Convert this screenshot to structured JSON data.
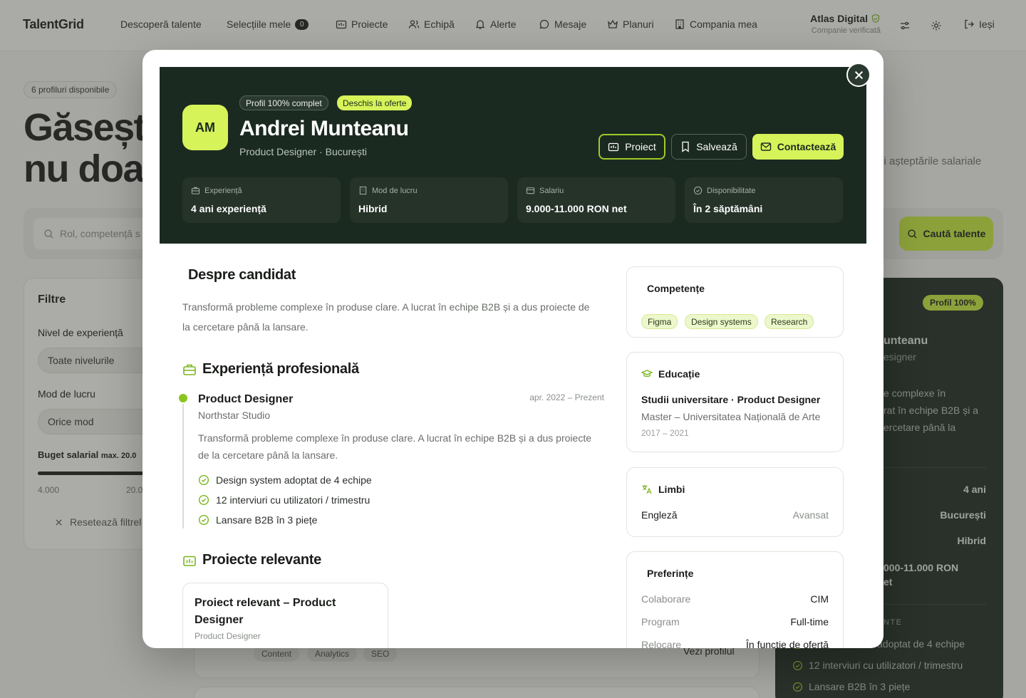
{
  "topnav": {
    "logo": "TalentGrid",
    "items": [
      "Descoperă talente",
      "Selecțiile mele",
      "Proiecte",
      "Echipă",
      "Alerte",
      "Mesaje",
      "Planuri",
      "Compania mea"
    ],
    "selections_count": "0",
    "company_name": "Atlas Digital",
    "company_status": "Companie verificată",
    "logout": "Ieși"
  },
  "background": {
    "profiles_pill": "6 profiluri disponibile",
    "hero_line1": "Găsește",
    "hero_line2": "nu doa",
    "hero_side": "și așteptările salariale",
    "search_placeholder": "Rol, competență s",
    "search_button": "Caută talente",
    "filters_title": "Filtre",
    "level_label": "Nivel de experiență",
    "level_value": "Toate nivelurile",
    "mode_label": "Mod de lucru",
    "mode_value": "Orice mod",
    "budget_label": "Buget salarial",
    "budget_max": "max. 20.0",
    "range_min": "4.000",
    "range_max": "20.0",
    "reset": "Resetează filtrel",
    "card_badge": "Profil 100%",
    "card_name": "unteanu",
    "card_role": "esigner",
    "card_desc": [
      "e complexe în",
      "rat în echipe B2B și a",
      "ercetare până la"
    ],
    "card_years": "4 ani",
    "card_city": "București",
    "card_mode": "Hibrid",
    "card_salary1": "000-11.000 RON",
    "card_salary2": "et",
    "card_section": "NTE",
    "card_bullets": [
      "adoptat de 4 echipe",
      "12 interviuri cu utilizatori / trimestru",
      "Lansare B2B în 3 piețe"
    ],
    "tags": [
      "Content",
      "Analytics",
      "SEO"
    ],
    "view_profile": "Vezi profilul"
  },
  "modal": {
    "avatar": "AM",
    "badge_complete": "Profil 100% complet",
    "badge_open": "Deschis la oferte",
    "name": "Andrei Munteanu",
    "role": "Product Designer · București",
    "btn_project": "Proiect",
    "btn_save": "Salvează",
    "btn_contact": "Contactează",
    "stats": [
      {
        "label": "Experiență",
        "value": "4 ani experiență"
      },
      {
        "label": "Mod de lucru",
        "value": "Hibrid"
      },
      {
        "label": "Salariu",
        "value": "9.000-11.000 RON net"
      },
      {
        "label": "Disponibilitate",
        "value": "În 2 săptămâni"
      }
    ],
    "about_title": "Despre candidat",
    "about_text_1": "Transformă probleme complexe în produse clare. A lucrat în echipe B2B și a dus proiecte de",
    "about_text_2": "la cercetare până la lansare.",
    "experience_title": "Experiență profesională",
    "exp": {
      "role": "Product Designer",
      "company": "Northstar Studio",
      "date": "apr. 2022 – Prezent",
      "desc_1": "Transformă probleme complexe în produse clare. A lucrat în echipe B2B și a dus proiecte",
      "desc_2": "de la cercetare până la lansare.",
      "bullets": [
        "Design system adoptat de 4 echipe",
        "12 interviuri cu utilizatori / trimestru",
        "Lansare B2B în 3 piețe"
      ]
    },
    "projects_title": "Proiecte relevante",
    "project": {
      "title_1": "Proiect relevant – Product",
      "title_2": "Designer",
      "subtitle": "Product Designer"
    },
    "skills_title": "Competențe",
    "skills": [
      "Figma",
      "Design systems",
      "Research"
    ],
    "education_title": "Educație",
    "education": {
      "degree": "Studii universitare · Product Designer",
      "school": "Master – Universitatea Națională de Arte",
      "years": "2017 – 2021"
    },
    "languages_title": "Limbi",
    "language": {
      "name": "Engleză",
      "level": "Avansat"
    },
    "preferences_title": "Preferințe",
    "preferences": [
      {
        "key": "Colaborare",
        "value": "CIM"
      },
      {
        "key": "Program",
        "value": "Full-time"
      },
      {
        "key": "Relocare",
        "value": "În funcție de ofertă"
      }
    ]
  },
  "colors": {
    "accent": "#d7f35a",
    "header_bg": "#1b2a21",
    "dark_card": "#1c2a22"
  }
}
